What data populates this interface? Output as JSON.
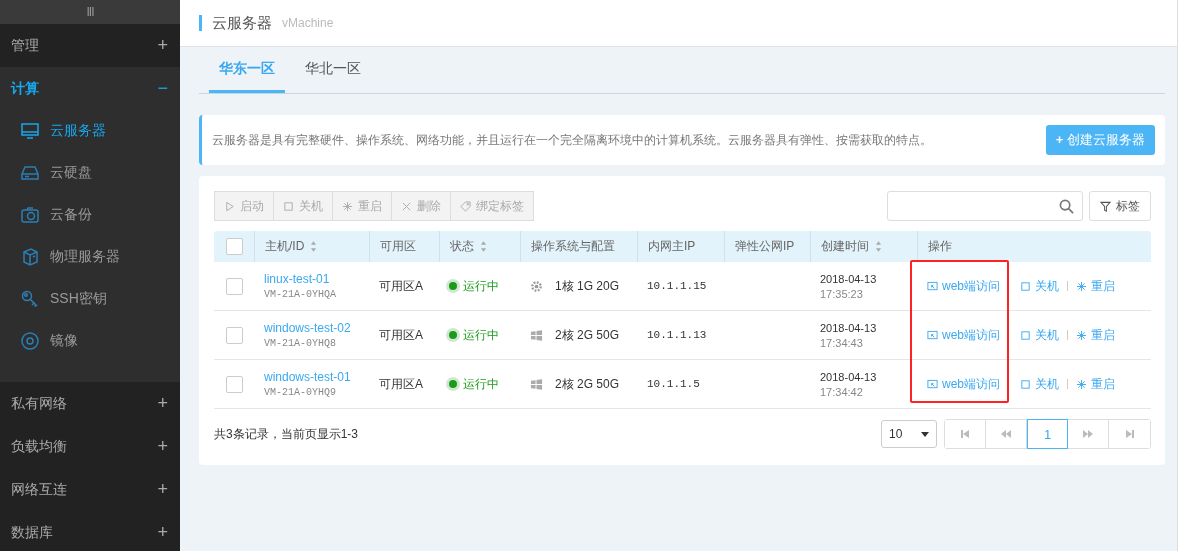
{
  "sidebar": {
    "handle": "III",
    "groups": [
      {
        "label": "管理",
        "expanded": false,
        "toggle": "+"
      },
      {
        "label": "计算",
        "expanded": true,
        "toggle": "−",
        "items": [
          {
            "label": "云服务器",
            "selected": true
          },
          {
            "label": "云硬盘",
            "selected": false
          },
          {
            "label": "云备份",
            "selected": false
          },
          {
            "label": "物理服务器",
            "selected": false
          },
          {
            "label": "SSH密钥",
            "selected": false
          },
          {
            "label": "镜像",
            "selected": false
          }
        ]
      },
      {
        "label": "私有网络",
        "expanded": false,
        "toggle": "+"
      },
      {
        "label": "负载均衡",
        "expanded": false,
        "toggle": "+"
      },
      {
        "label": "网络互连",
        "expanded": false,
        "toggle": "+"
      },
      {
        "label": "数据库",
        "expanded": false,
        "toggle": "+"
      }
    ]
  },
  "header": {
    "title": "云服务器",
    "subtitle": "vMachine"
  },
  "tabs": [
    {
      "label": "华东一区",
      "selected": true
    },
    {
      "label": "华北一区",
      "selected": false
    }
  ],
  "info": {
    "text": "云服务器是具有完整硬件、操作系统、网络功能，并且运行在一个完全隔离环境中的计算机系统。云服务器具有弹性、按需获取的特点。",
    "create_button": "创建云服务器",
    "create_icon": "+"
  },
  "toolbar": {
    "buttons": [
      {
        "label": "启动",
        "kind": "play"
      },
      {
        "label": "关机",
        "kind": "stop"
      },
      {
        "label": "重启",
        "kind": "restart"
      },
      {
        "label": "删除",
        "kind": "delete"
      },
      {
        "label": "绑定标签",
        "kind": "tag"
      }
    ],
    "tag_filter": "标签"
  },
  "table": {
    "columns": [
      {
        "label": "主机/ID",
        "sortable": true
      },
      {
        "label": "可用区",
        "sortable": false
      },
      {
        "label": "状态",
        "sortable": true
      },
      {
        "label": "操作系统与配置",
        "sortable": false
      },
      {
        "label": "内网主IP",
        "sortable": false
      },
      {
        "label": "弹性公网IP",
        "sortable": false
      },
      {
        "label": "创建时间",
        "sortable": true
      },
      {
        "label": "操作",
        "sortable": false
      }
    ],
    "select_all_checked": false,
    "rows": [
      {
        "checked": false,
        "name": "linux-test-01",
        "id": "VM-21A-0YHQA",
        "zone": "可用区A",
        "status": "运行中",
        "color": "#1a9b1a",
        "kind": "linux",
        "config": "1核 1G 20G",
        "ip": "10.1.1.15",
        "date": "2018-04-13",
        "time": "17:35:23",
        "actions": [
          "web端访问",
          "关机",
          "重启"
        ]
      },
      {
        "checked": false,
        "name": "windows-test-02",
        "id": "VM-21A-0YHQ8",
        "zone": "可用区A",
        "status": "运行中",
        "color": "#1a9b1a",
        "kind": "windows",
        "config": "2核 2G 50G",
        "ip": "10.1.1.13",
        "date": "2018-04-13",
        "time": "17:34:43",
        "actions": [
          "web端访问",
          "关机",
          "重启"
        ]
      },
      {
        "checked": false,
        "name": "windows-test-01",
        "id": "VM-21A-0YHQ9",
        "zone": "可用区A",
        "status": "运行中",
        "color": "#1a9b1a",
        "kind": "windows",
        "config": "2核 2G 50G",
        "ip": "10.1.1.5",
        "date": "2018-04-13",
        "time": "17:34:42",
        "actions": [
          "web端访问",
          "关机",
          "重启"
        ]
      }
    ]
  },
  "footer": {
    "summary": "共3条记录，当前页显示1-3",
    "page_size": "10",
    "pages": [
      {
        "label": "1",
        "selected": true
      }
    ]
  }
}
